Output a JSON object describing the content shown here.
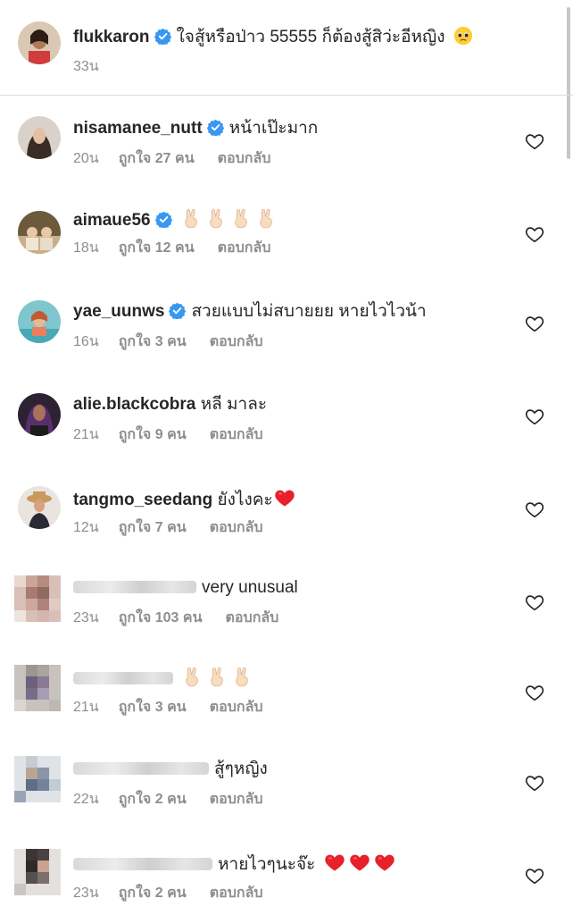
{
  "post": {
    "username": "flukkaron",
    "caption": "ใจสู้หรือป่าว 55555 ก็ต้องสู้สิว่ะอีหญิง",
    "time": "33น"
  },
  "comments": [
    {
      "username": "nisamanee_nutt",
      "text": "หน้าเป๊ะมาก",
      "time": "20น",
      "likes": "ถูกใจ 27 คน",
      "reply": "ตอบกลับ"
    },
    {
      "username": "aimaue56",
      "text": "",
      "time": "18น",
      "likes": "ถูกใจ 12 คน",
      "reply": "ตอบกลับ"
    },
    {
      "username": "yae_uunws",
      "text": "สวยแบบไม่สบายยย หายไวไวน้า",
      "time": "16น",
      "likes": "ถูกใจ 3 คน",
      "reply": "ตอบกลับ"
    },
    {
      "username": "alie.blackcobra",
      "text": "หลี มาละ",
      "time": "21น",
      "likes": "ถูกใจ 9 คน",
      "reply": "ตอบกลับ"
    },
    {
      "username": "tangmo_seedang",
      "text": "ยังไงคะ",
      "time": "12น",
      "likes": "ถูกใจ 7 คน",
      "reply": "ตอบกลับ"
    },
    {
      "username": "",
      "text": "very unusual",
      "time": "23น",
      "likes": "ถูกใจ 103 คน",
      "reply": "ตอบกลับ"
    },
    {
      "username": "",
      "text": "",
      "time": "21น",
      "likes": "ถูกใจ 3 คน",
      "reply": "ตอบกลับ"
    },
    {
      "username": "",
      "text": "สู้ๆหญิง",
      "time": "22น",
      "likes": "ถูกใจ 2 คน",
      "reply": "ตอบกลับ"
    },
    {
      "username": "",
      "text": "หายไวๆนะจ๊ะ",
      "time": "23น",
      "likes": "ถูกใจ 2 คน",
      "reply": "ตอบกลับ"
    }
  ],
  "colors": {
    "text": "#262626",
    "meta": "#8e8e8e",
    "verified": "#3897f0",
    "heart_red": "#e8202a",
    "divider": "#dbdbdb"
  },
  "icons": {
    "verified": "verified-badge-icon",
    "like": "heart-outline-icon"
  }
}
